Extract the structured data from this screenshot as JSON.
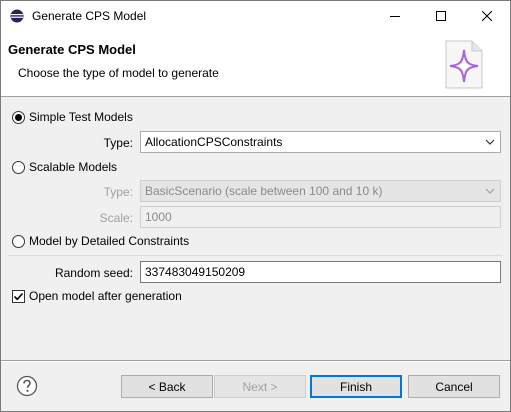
{
  "window": {
    "title": "Generate CPS Model"
  },
  "header": {
    "title": "Generate CPS Model",
    "description": "Choose the type of model to generate"
  },
  "options": {
    "simple": {
      "label": "Simple Test Models",
      "checked": true,
      "type_label": "Type:",
      "type_value": "AllocationCPSConstraints"
    },
    "scalable": {
      "label": "Scalable Models",
      "checked": false,
      "type_label": "Type:",
      "type_value": "BasicScenario (scale between 100 and 10 k)",
      "scale_label": "Scale:",
      "scale_value": "1000"
    },
    "detailed": {
      "label": "Model by Detailed Constraints",
      "checked": false
    }
  },
  "random_seed": {
    "label": "Random seed:",
    "value": "337483049150209"
  },
  "open_after": {
    "label": "Open model after generation",
    "checked": true
  },
  "buttons": {
    "back": "< Back",
    "next": "Next >",
    "finish": "Finish",
    "cancel": "Cancel"
  },
  "icons": {
    "app": "eclipse-icon",
    "help": "help-icon",
    "wizard": "sparkle-wizard-icon"
  },
  "colors": {
    "accent": "#0078d7",
    "sparkle": "#b07adf"
  }
}
